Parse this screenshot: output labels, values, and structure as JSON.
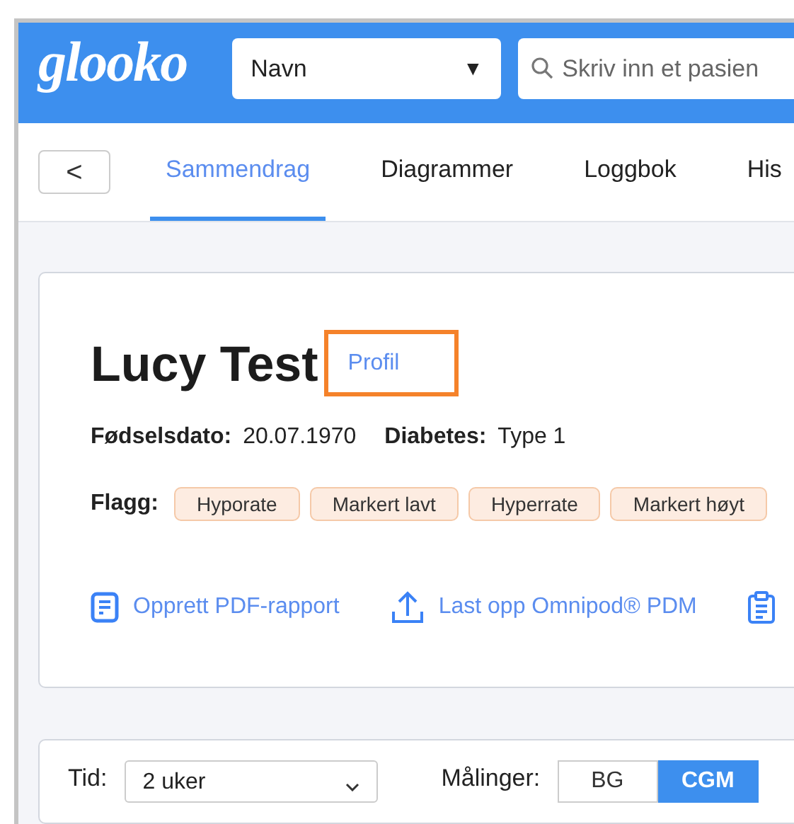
{
  "header": {
    "logo": "glooko",
    "search_type": {
      "value": "Navn",
      "caret": "▼"
    },
    "search": {
      "placeholder": "Skriv inn et pasien"
    }
  },
  "back_button": {
    "label": "<"
  },
  "tabs": [
    {
      "label": "Sammendrag",
      "selected": true
    },
    {
      "label": "Diagrammer",
      "selected": false
    },
    {
      "label": "Loggbok",
      "selected": false
    },
    {
      "label": "His",
      "selected": false
    }
  ],
  "patient": {
    "name": "Lucy Test",
    "profile_link": {
      "label": "Profil",
      "highlighted": true
    },
    "details": [
      {
        "label": "Fødselsdato:",
        "value": "20.07.1970"
      },
      {
        "label": "Diabetes:",
        "value": "Type 1"
      }
    ],
    "flags_label": "Flagg:",
    "flags": [
      "Hyporate",
      "Markert lavt",
      "Hyperrate",
      "Markert høyt"
    ],
    "actions": [
      {
        "kind": "report",
        "label": "Opprett PDF-rapport"
      },
      {
        "kind": "upload",
        "label": "Last opp Omnipod® PDM"
      },
      {
        "kind": "clipboard"
      }
    ]
  },
  "filters": {
    "time_label": "Tid:",
    "time_value": "2 uker",
    "measure_label": "Målinger:",
    "measures": [
      {
        "label": "BG",
        "selected": false
      },
      {
        "label": "CGM",
        "selected": true
      }
    ]
  }
}
